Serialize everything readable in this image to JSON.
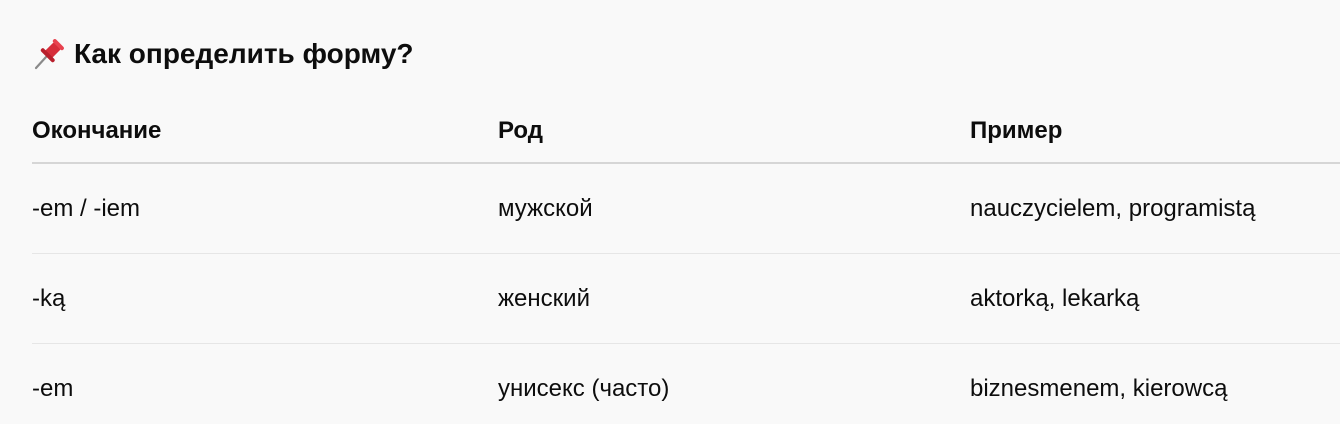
{
  "heading": {
    "icon": "pushpin-icon",
    "title": "Как определить форму?"
  },
  "table": {
    "columns": [
      "Окончание",
      "Род",
      "Пример"
    ],
    "rows": [
      [
        "-em / -iem",
        "мужской",
        "nauczycielem, programistą"
      ],
      [
        "-ką",
        "женский",
        "aktorką, lekarką"
      ],
      [
        "-em",
        "унисекс (часто)",
        "biznesmenem, kierowcą"
      ]
    ]
  },
  "colors": {
    "background": "#f9f9f9",
    "text": "#0d0d0d",
    "pin": "#d62d3a"
  }
}
